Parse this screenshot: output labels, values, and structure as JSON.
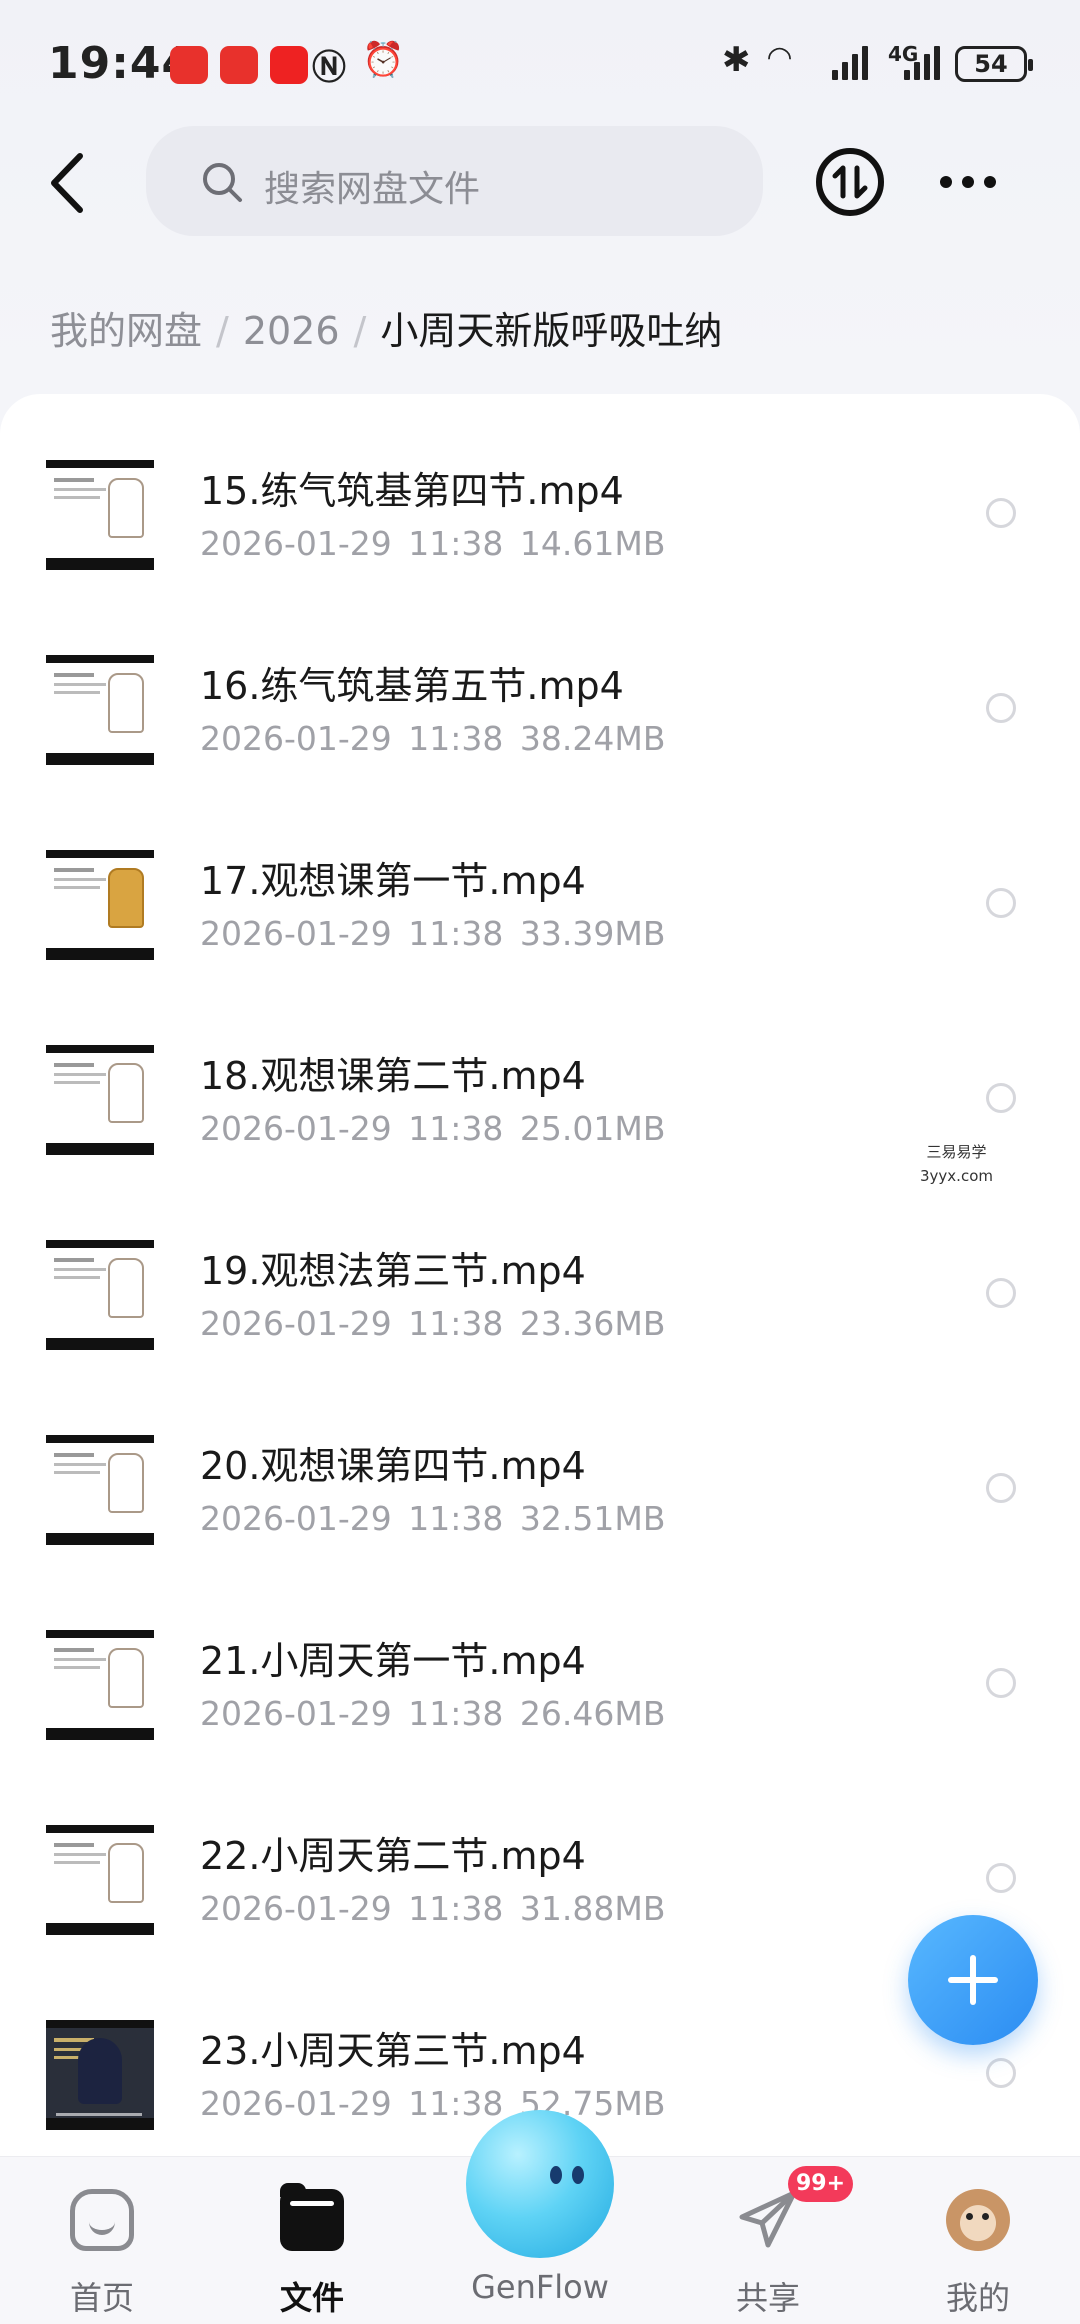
{
  "status_bar": {
    "time": "19:44",
    "network": "4G",
    "battery": "54"
  },
  "header": {
    "search_placeholder": "搜索网盘文件"
  },
  "breadcrumb": {
    "root": "我的网盘",
    "folder": "2026",
    "current": "小周天新版呼吸吐纳"
  },
  "files": [
    {
      "name": "15.练气筑基第四节.mp4",
      "date": "2026-01-29",
      "time": "11:38",
      "size": "14.61MB",
      "thumb": "diagram"
    },
    {
      "name": "16.练气筑基第五节.mp4",
      "date": "2026-01-29",
      "time": "11:38",
      "size": "38.24MB",
      "thumb": "diagram"
    },
    {
      "name": "17.观想课第一节.mp4",
      "date": "2026-01-29",
      "time": "11:38",
      "size": "33.39MB",
      "thumb": "gold"
    },
    {
      "name": "18.观想课第二节.mp4",
      "date": "2026-01-29",
      "time": "11:38",
      "size": "25.01MB",
      "thumb": "painting"
    },
    {
      "name": "19.观想法第三节.mp4",
      "date": "2026-01-29",
      "time": "11:38",
      "size": "23.36MB",
      "thumb": "painting"
    },
    {
      "name": "20.观想课第四节.mp4",
      "date": "2026-01-29",
      "time": "11:38",
      "size": "32.51MB",
      "thumb": "diagram"
    },
    {
      "name": "21.小周天第一节.mp4",
      "date": "2026-01-29",
      "time": "11:38",
      "size": "26.46MB",
      "thumb": "diagram"
    },
    {
      "name": "22.小周天第二节.mp4",
      "date": "2026-01-29",
      "time": "11:38",
      "size": "31.88MB",
      "thumb": "text"
    },
    {
      "name": "23.小周天第三节.mp4",
      "date": "2026-01-29",
      "time": "11:38",
      "size": "52.75MB",
      "thumb": "photo"
    }
  ],
  "watermark": {
    "line1": "三易易学",
    "line2": "3yyx.com"
  },
  "tabbar": {
    "home": "首页",
    "files": "文件",
    "genflow": "GenFlow",
    "share": "共享",
    "share_badge": "99+",
    "me": "我的"
  },
  "colors": {
    "accent": "#2b8cf2",
    "badge": "#f33a5a"
  }
}
